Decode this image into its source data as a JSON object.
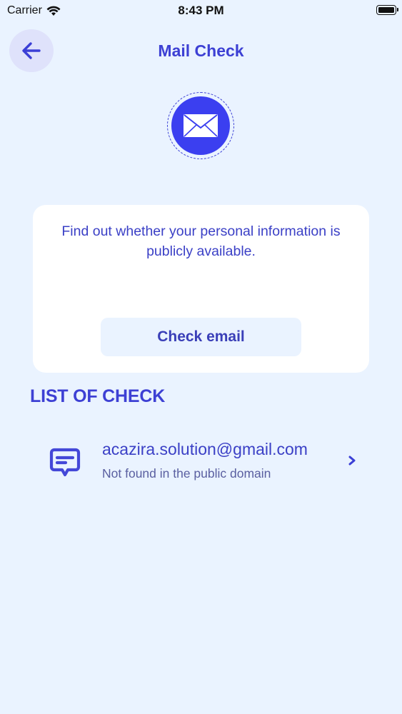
{
  "status_bar": {
    "carrier": "Carrier",
    "time": "8:43 PM"
  },
  "header": {
    "title": "Mail Check",
    "back_icon": "arrow-left-icon"
  },
  "hero": {
    "icon": "envelope-icon",
    "accent_color": "#3b3ff0"
  },
  "info_card": {
    "text": "Find out whether your personal information is publicly available.",
    "button_label": "Check email"
  },
  "list": {
    "title": "LIST OF CHECK",
    "items": [
      {
        "icon": "message-icon",
        "email": "acazira.solution@gmail.com",
        "status": "Not found in the public domain"
      }
    ]
  }
}
